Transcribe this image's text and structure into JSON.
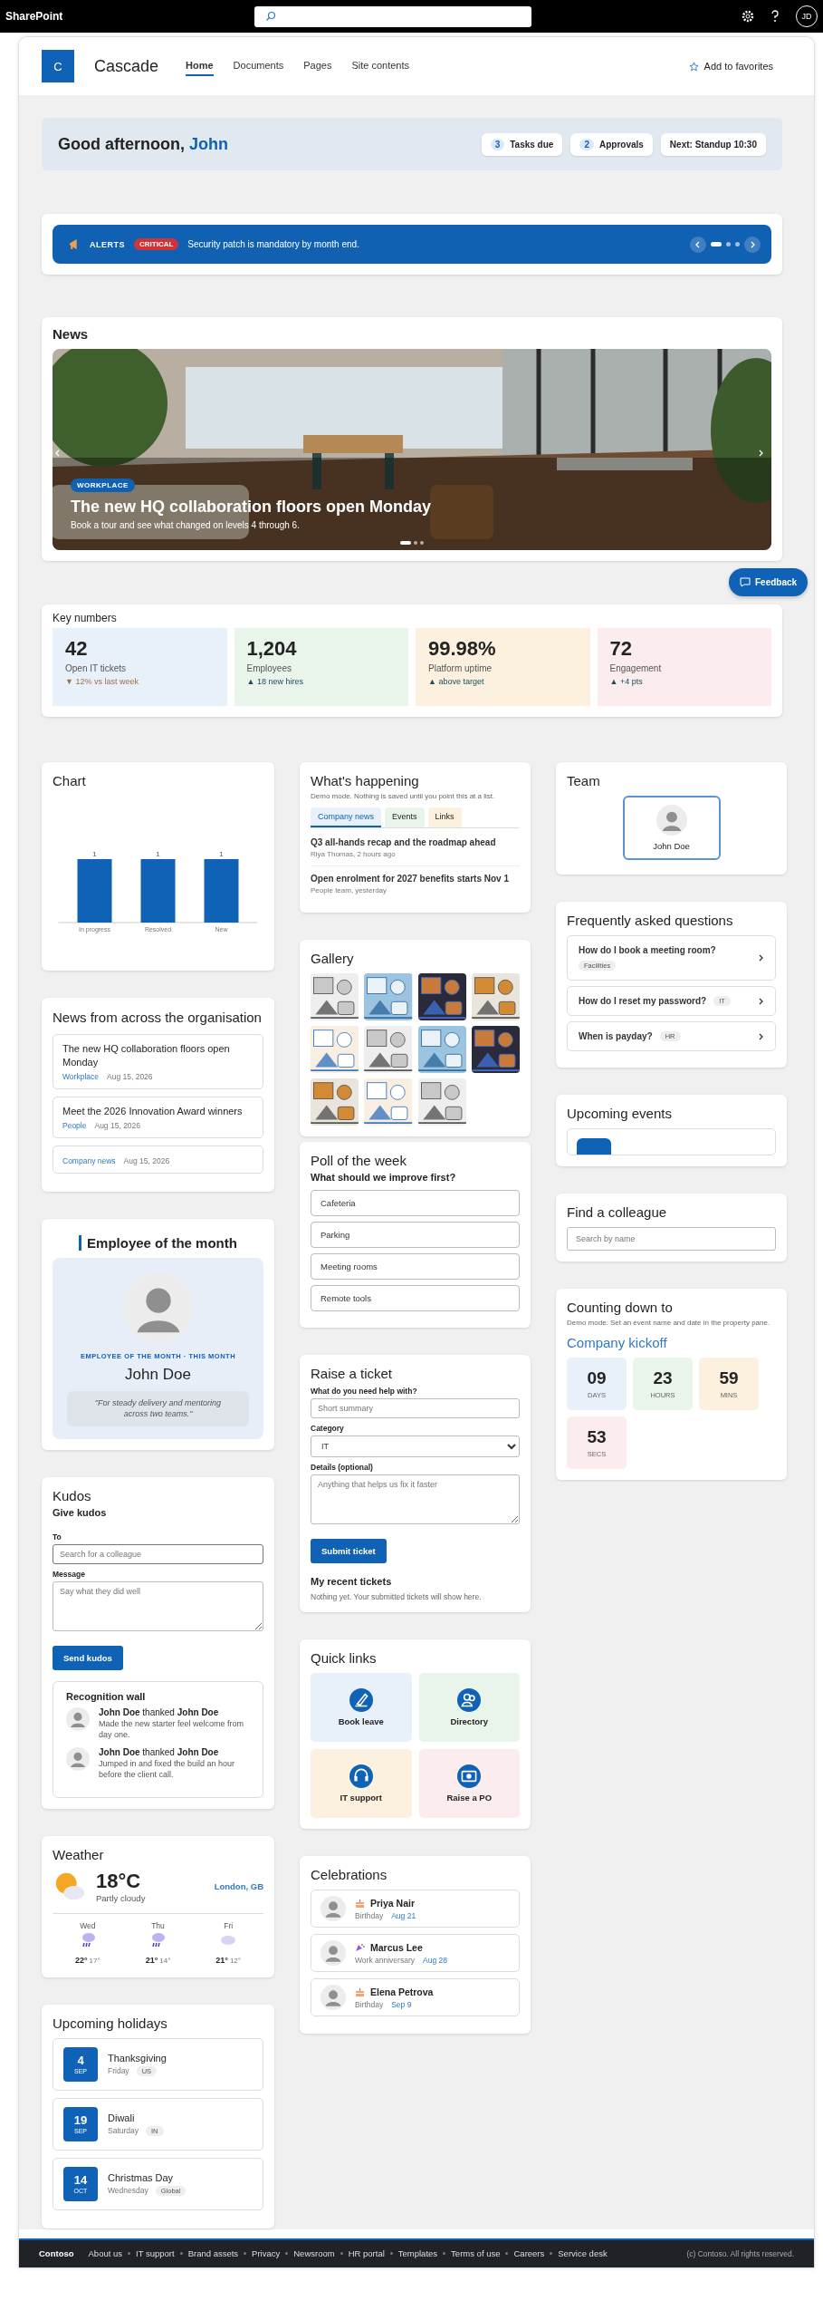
{
  "top_bar": {
    "app_name": "SharePoint",
    "user_initials": "JD"
  },
  "site": {
    "logo_letter": "C",
    "title": "Cascade",
    "favorite": "Add to favorites",
    "nav": [
      {
        "label": "Home",
        "selected": true
      },
      {
        "label": "Documents",
        "selected": false
      },
      {
        "label": "Pages",
        "selected": false
      },
      {
        "label": "Site contents",
        "selected": false
      }
    ]
  },
  "welcome": {
    "greeting": "Good afternoon,",
    "name": "John",
    "chips": [
      {
        "count": "3",
        "label": "Tasks due"
      },
      {
        "count": "2",
        "label": "Approvals"
      },
      {
        "label": "Next: Standup 10:30"
      }
    ]
  },
  "alerts": {
    "label": "ALERTS",
    "severity": "CRITICAL",
    "message": "Security patch is mandatory by month end.",
    "slides": [
      {
        "selected": true
      },
      {
        "selected": false
      },
      {
        "selected": false
      }
    ]
  },
  "news": {
    "title": "News",
    "tag": "WORKPLACE",
    "headline": "The new HQ collaboration floors open Monday",
    "summary": "Book a tour and see what changed on levels 4 through 6.",
    "slides": [
      {
        "selected": true
      },
      {
        "selected": false
      },
      {
        "selected": false
      }
    ]
  },
  "feedback": "Feedback",
  "key_numbers": {
    "title": "Key numbers",
    "tiles": [
      {
        "value": "42",
        "label": "Open IT tickets",
        "trend": "▼ 12% vs last week",
        "kind": "falling",
        "color": "#e8f0fa"
      },
      {
        "value": "1,204",
        "label": "Employees",
        "trend": "▲ 18 new hires",
        "kind": "rising",
        "color": "#e9f4ea"
      },
      {
        "value": "99.98%",
        "label": "Platform uptime",
        "trend": "▲ above target",
        "kind": "rising",
        "color": "#fbf1de"
      },
      {
        "value": "72",
        "label": "Engagement",
        "trend": "▲ +4 pts",
        "kind": "rising",
        "color": "#fbeced"
      }
    ]
  },
  "chart": {
    "title": "Chart",
    "chart_data": {
      "type": "bar",
      "categories": [
        "In progress",
        "Resolved",
        "New"
      ],
      "values": [
        1,
        1,
        1
      ],
      "data_labels": true
    }
  },
  "org_news": {
    "title": "News from across the organisation",
    "items": [
      {
        "title": "The new HQ collaboration floors open Monday",
        "category": "Workplace",
        "date": "Aug 15, 2026"
      },
      {
        "title": "Meet the 2026 Innovation Award winners",
        "category": "People",
        "date": "Aug 15, 2026"
      },
      {
        "category": "Company news",
        "date": "Aug 15, 2026"
      }
    ]
  },
  "employee_of_month": {
    "title": "Employee of the month",
    "caption": "EMPLOYEE OF THE MONTH · THIS MONTH",
    "name": "John Doe",
    "quote": "\"For steady delivery and mentoring across two teams.\""
  },
  "kudos": {
    "title": "Kudos",
    "subtitle": "Give kudos",
    "to_label": "To",
    "to_placeholder": "Search for a colleague",
    "message_label": "Message",
    "message_placeholder": "Say what they did well",
    "button": "Send kudos",
    "wall_title": "Recognition wall",
    "wall": [
      {
        "line": "**John Doe** thanked **John Doe**",
        "message": "Made the new starter feel welcome from day one."
      },
      {
        "line": "**John Doe** thanked **John Doe**",
        "message": "Jumped in and fixed the build an hour before the client call."
      }
    ]
  },
  "weather": {
    "title": "Weather",
    "temp": "18°C",
    "condition": "Partly cloudy",
    "location": "London, GB",
    "forecast": [
      {
        "day": "Wed",
        "high": "22°",
        "low": "17°",
        "kind": "rain"
      },
      {
        "day": "Thu",
        "high": "21°",
        "low": "14°",
        "kind": "rain"
      },
      {
        "day": "Fri",
        "high": "21°",
        "low": "12°",
        "kind": "cloud"
      }
    ]
  },
  "holidays": {
    "title": "Upcoming holidays",
    "items": [
      {
        "day": "4",
        "month": "SEP",
        "name": "Thanksgiving",
        "weekday": "Friday",
        "region": "US"
      },
      {
        "day": "19",
        "month": "SEP",
        "name": "Diwali",
        "weekday": "Saturday",
        "region": "IN"
      },
      {
        "day": "14",
        "month": "OCT",
        "name": "Christmas Day",
        "weekday": "Wednesday",
        "region": "Global"
      }
    ]
  },
  "whats_happening": {
    "title": "What's happening",
    "note": "Demo mode. Nothing is saved until you point this at a list.",
    "tabs": [
      {
        "label": "Company news",
        "selected": true,
        "color": "#e8f0fa"
      },
      {
        "label": "Events",
        "selected": false,
        "color": "#e9f4ea"
      },
      {
        "label": "Links",
        "selected": false,
        "color": "#fbf1de"
      }
    ],
    "items": [
      {
        "title": "Q3 all-hands recap and the roadmap ahead",
        "meta": "Riya Thomas, 2 hours ago"
      },
      {
        "title": "Open enrolment for 2027 benefits starts Nov 1",
        "meta": "People team, yesterday"
      }
    ]
  },
  "gallery": {
    "title": "Gallery"
  },
  "poll": {
    "title": "Poll of the week",
    "question": "What should we improve first?",
    "options": [
      "Cafeteria",
      "Parking",
      "Meeting rooms",
      "Remote tools"
    ]
  },
  "ticket": {
    "title": "Raise a ticket",
    "summary_label": "What do you need help with?",
    "summary_placeholder": "Short summary",
    "category_label": "Category",
    "category_value": "IT",
    "details_label": "Details (optional)",
    "details_placeholder": "Anything that helps us fix it faster",
    "button": "Submit ticket",
    "recent_title": "My recent tickets",
    "recent_empty": "Nothing yet. Your submitted tickets will show here."
  },
  "quick_links": {
    "title": "Quick links",
    "links": [
      {
        "label": "Book leave",
        "kind": "leave",
        "color": "#e8f0fa"
      },
      {
        "label": "Directory",
        "kind": "people",
        "color": "#e9f4ea"
      },
      {
        "label": "IT support",
        "kind": "support",
        "color": "#fbf1de"
      },
      {
        "label": "Raise a PO",
        "kind": "money",
        "color": "#fbeced"
      }
    ]
  },
  "celebrations": {
    "title": "Celebrations",
    "items": [
      {
        "name": "Priya Nair",
        "kind": "birthday",
        "type_label": "Birthday",
        "date": "Aug 21"
      },
      {
        "name": "Marcus Lee",
        "kind": "anniversary",
        "type_label": "Work anniversary",
        "date": "Aug 28"
      },
      {
        "name": "Elena Petrova",
        "kind": "birthday",
        "type_label": "Birthday",
        "date": "Sep 9"
      }
    ]
  },
  "team": {
    "title": "Team",
    "members": [
      {
        "name": "John Doe"
      }
    ]
  },
  "faq": {
    "title": "Frequently asked questions",
    "items": [
      {
        "question": "How do I book a meeting room?",
        "tag": "Facilities"
      },
      {
        "question": "How do I reset my password?",
        "tag": "IT"
      },
      {
        "question": "When is payday?",
        "tag": "HR"
      }
    ]
  },
  "upcoming_events": {
    "title": "Upcoming events"
  },
  "find_colleague": {
    "title": "Find a colleague",
    "placeholder": "Search by name"
  },
  "countdown": {
    "title": "Counting down to",
    "note": "Demo mode. Set an event name and date in the property pane.",
    "event": "Company kickoff",
    "units": [
      {
        "value": "09",
        "label": "DAYS",
        "color": "#e8f0fa"
      },
      {
        "value": "23",
        "label": "HOURS",
        "color": "#e9f4ea"
      },
      {
        "value": "59",
        "label": "MINS",
        "color": "#fbf1de"
      },
      {
        "value": "53",
        "label": "SECS",
        "color": "#fbeced"
      }
    ]
  },
  "footer": {
    "brand": "Contoso",
    "links": [
      "About us",
      "IT support",
      "Brand assets",
      "Privacy",
      "Newsroom",
      "HR portal",
      "Templates",
      "Terms of use",
      "Careers",
      "Service desk"
    ],
    "copyright": "(c) Contoso. All rights reserved."
  }
}
